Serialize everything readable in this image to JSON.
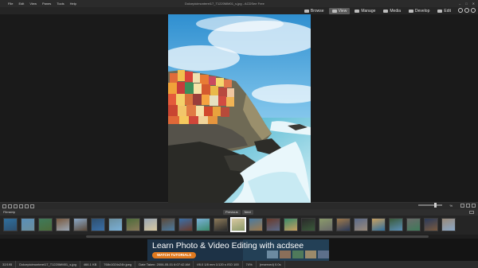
{
  "menu": [
    "File",
    "Edit",
    "View",
    "Panes",
    "Tools",
    "Help"
  ],
  "window_title": "Dolcepicimonterei17_T1220MM01_s.jpg - ACDSee Free",
  "window_controls": [
    "–",
    "□",
    "✕"
  ],
  "modes": [
    {
      "label": "Browse",
      "icon": "browse-icon",
      "active": false
    },
    {
      "label": "View",
      "icon": "eye-icon",
      "active": true
    },
    {
      "label": "Manage",
      "icon": "grid-icon",
      "active": false
    },
    {
      "label": "Media",
      "icon": "media-icon",
      "active": false
    },
    {
      "label": "Develop",
      "icon": "develop-icon",
      "active": false
    },
    {
      "label": "Edit",
      "icon": "brush-icon",
      "active": false
    }
  ],
  "zoom": {
    "label": "%",
    "value_fraction": 0.75
  },
  "filmstrip": {
    "label": "Filmstrip",
    "previous_label": "Previous",
    "next_label": "Next",
    "selected_index": 13,
    "thumbnail_count": 26
  },
  "ad": {
    "headline": "Learn Photo & Video Editing with acdsee",
    "button_label": "WATCH TUTORIALS"
  },
  "status": {
    "index": "32/195",
    "filename": "Dolcepicimonterei17_T1220MM01_s.jpg",
    "filesize": "466.1 KB",
    "dimensions": "768x1024x24b jpeg",
    "date_taken": "Date Taken: 2006-05-01 6:07:42 AM",
    "exposure": "f/8.0    1/8 mm    1/120 s    ISO 100",
    "zoom": "74%",
    "extra": "(reserved) 0.0s"
  }
}
